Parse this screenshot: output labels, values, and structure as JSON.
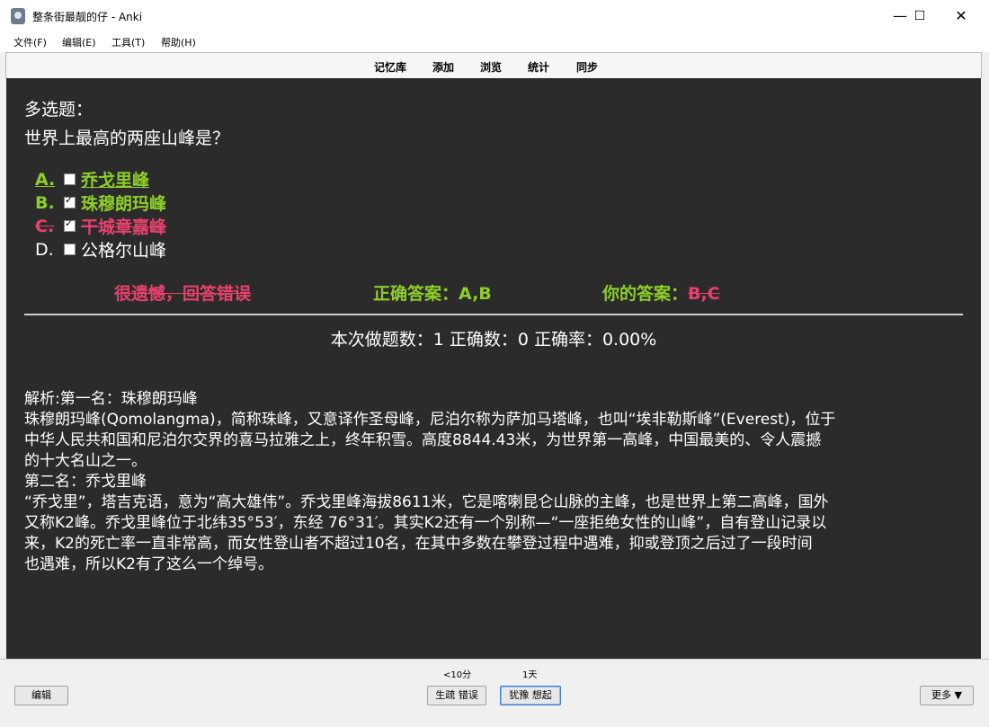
{
  "window": {
    "title": "整条街最靓的仔 - Anki"
  },
  "window_controls": {
    "minimize": "—",
    "maximize": "☐",
    "close": "✕"
  },
  "menu": [
    "文件(F)",
    "编辑(E)",
    "工具(T)",
    "帮助(H)"
  ],
  "toolbar": [
    "记忆库",
    "添加",
    "浏览",
    "统计",
    "同步"
  ],
  "card": {
    "type_label": "多选题：",
    "question": "世界上最高的两座山峰是？",
    "options": [
      {
        "letter": "A.",
        "text": "乔戈里峰",
        "checked": false
      },
      {
        "letter": "B.",
        "text": "珠穆朗玛峰",
        "checked": true
      },
      {
        "letter": "C.",
        "text": "干城章嘉峰",
        "checked": true
      },
      {
        "letter": "D.",
        "text": "公格尔山峰",
        "checked": false
      }
    ],
    "result": "很遗憾，回答错误",
    "correct_label": "正确答案：",
    "correct_value": "A,B",
    "your_label": "你的答案：",
    "your_value": "B,C",
    "stats": "本次做题数：1 正确数：0 正确率：0.00%",
    "explanation": [
      "解析:第一名：珠穆朗玛峰",
      "珠穆朗玛峰(Qomolangma)，简称珠峰，又意译作圣母峰，尼泊尔称为萨加马塔峰，也叫“埃非勒斯峰”(Everest)，位于",
      "中华人民共和国和尼泊尔交界的喜马拉雅之上，终年积雪。高度8844.43米，为世界第一高峰，中国最美的、令人震撼",
      "的十大名山之一。",
      "第二名：乔戈里峰",
      "“乔戈里”，塔吉克语，意为“高大雄伟”。乔戈里峰海拔8611米，它是喀喇昆仑山脉的主峰，也是世界上第二高峰，国外",
      "又称K2峰。乔戈里峰位于北纬35°53′，东经 76°31′。其实K2还有一个别称—“一座拒绝女性的山峰”，自有登山记录以",
      "来，K2的死亡率一直非常高，而女性登山者不超过10名，在其中多数在攀登过程中遇难，抑或登顶之后过了一段时间",
      "也遇难，所以K2有了这么一个绰号。"
    ]
  },
  "bottom": {
    "edit": "编辑",
    "interval_1": "<10分",
    "interval_2": "1天",
    "again": "生疏 错误",
    "hard": "犹豫 想起",
    "more": "更多 ▼"
  }
}
